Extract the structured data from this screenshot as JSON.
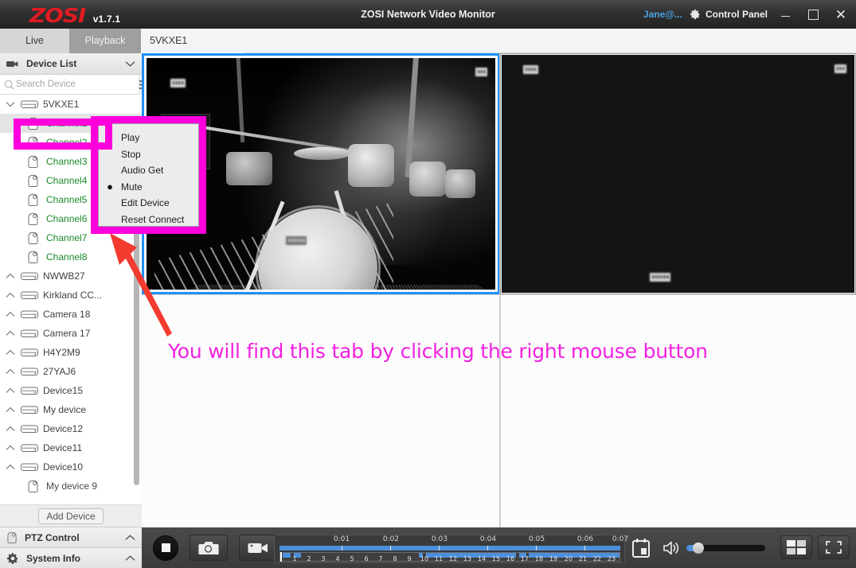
{
  "titlebar": {
    "logo_text": "ZOSI",
    "version": "v1.7.1",
    "app_title": "ZOSI Network Video Monitor",
    "user": "Jane@...",
    "control_panel": "Control Panel",
    "minimize_label": "—",
    "maximize_label": "□",
    "close_label": "✕"
  },
  "tabs": [
    {
      "label": "Live",
      "active": false
    },
    {
      "label": "Playback",
      "active": true
    },
    {
      "label": "5VKXE1",
      "active": false
    }
  ],
  "sidebar": {
    "header": {
      "title": "Device List"
    },
    "search": {
      "placeholder": "Search Device",
      "value": ""
    },
    "add_device_label": "Add Device",
    "sections": [
      {
        "label": "PTZ Control"
      },
      {
        "label": "System Info"
      }
    ],
    "items": [
      {
        "label": "5VKXE1",
        "type": "device",
        "expanded": true,
        "selected": false
      },
      {
        "label": "Channel1",
        "type": "channel",
        "selected": true
      },
      {
        "label": "Channel2",
        "type": "channel",
        "selected": false
      },
      {
        "label": "Channel3",
        "type": "channel",
        "selected": false
      },
      {
        "label": "Channel4",
        "type": "channel",
        "selected": false
      },
      {
        "label": "Channel5",
        "type": "channel",
        "selected": false
      },
      {
        "label": "Channel6",
        "type": "channel",
        "selected": false
      },
      {
        "label": "Channel7",
        "type": "channel",
        "selected": false
      },
      {
        "label": "Channel8",
        "type": "channel",
        "selected": false
      },
      {
        "label": "NWWB27",
        "type": "device",
        "expanded": false,
        "selected": false
      },
      {
        "label": "Kirkland CC...",
        "type": "device",
        "expanded": false,
        "selected": false
      },
      {
        "label": "Camera 18",
        "type": "device",
        "expanded": false,
        "selected": false
      },
      {
        "label": "Camera 17",
        "type": "device",
        "expanded": false,
        "selected": false
      },
      {
        "label": "H4Y2M9",
        "type": "device",
        "expanded": false,
        "selected": false
      },
      {
        "label": "27YAJ6",
        "type": "device",
        "expanded": false,
        "selected": false
      },
      {
        "label": "Device15",
        "type": "device",
        "expanded": false,
        "selected": false
      },
      {
        "label": "My device",
        "type": "device",
        "expanded": false,
        "selected": false
      },
      {
        "label": "Device12",
        "type": "device",
        "expanded": false,
        "selected": false
      },
      {
        "label": "Device11",
        "type": "device",
        "expanded": false,
        "selected": false
      },
      {
        "label": "Device10",
        "type": "device",
        "expanded": false,
        "selected": false
      },
      {
        "label": "My device 9",
        "type": "channel",
        "selected": false
      }
    ]
  },
  "context_menu": {
    "items": [
      {
        "label": "Play",
        "bullet": true
      },
      {
        "label": "Stop",
        "bullet": false
      },
      {
        "label": "Audio Get",
        "bullet": false
      },
      {
        "label": "Mute",
        "bullet": true
      },
      {
        "label": "Edit Device",
        "bullet": false
      },
      {
        "label": "Reset Connect",
        "bullet": false
      }
    ]
  },
  "annotation": {
    "text": "You will find this tab by clicking the right mouse button",
    "text_color": "#f221e0",
    "highlight_color": "#ff00dd",
    "arrow_color": "#f33b30"
  },
  "video": {
    "cell1": {
      "osd_left": "▮▮▮▮",
      "osd_right": "▮▮▮",
      "selected": true
    },
    "cell2": {
      "osd_left": "▮▮▮▮",
      "osd_right": "▮▮▮",
      "osd_bottom": "▮▮▮▮▮▮",
      "selected": false
    },
    "cell3": {
      "empty": true
    },
    "cell4": {
      "empty": true
    }
  },
  "toolbar": {
    "stop_label": "stop",
    "snapshot_label": "snapshot",
    "record_label": "record",
    "calendar_label": "calendar",
    "volume_label": "volume",
    "volume_value": 14,
    "layout_label": "layout",
    "fullscreen_label": "fullscreen"
  },
  "timeline": {
    "hour_labels": [
      "0:01",
      "0:02",
      "0:03",
      "0:04",
      "0:05",
      "0:06",
      "0:07"
    ],
    "minute_labels": [
      "1",
      "2",
      "3",
      "4",
      "5",
      "6",
      "7",
      "8",
      "9",
      "10",
      "11",
      "12",
      "13",
      "14",
      "15",
      "16",
      "17",
      "18",
      "19",
      "20",
      "21",
      "22",
      "23"
    ],
    "recorded_segments": [
      {
        "start": 0.5,
        "end": 2.2
      },
      {
        "start": 3.0,
        "end": 5.0
      },
      {
        "start": 29.5,
        "end": 31.0
      },
      {
        "start": 32.0,
        "end": 50.0
      },
      {
        "start": 50.5,
        "end": 52.0
      },
      {
        "start": 53.0,
        "end": 72.0
      }
    ]
  },
  "colors": {
    "accent_blue": "#1e90ff",
    "timeline_blue": "#4d8fdb",
    "channel_green": "#1a8a2a",
    "logo_red": "#e01b22",
    "user_blue": "#4aa3e0"
  }
}
